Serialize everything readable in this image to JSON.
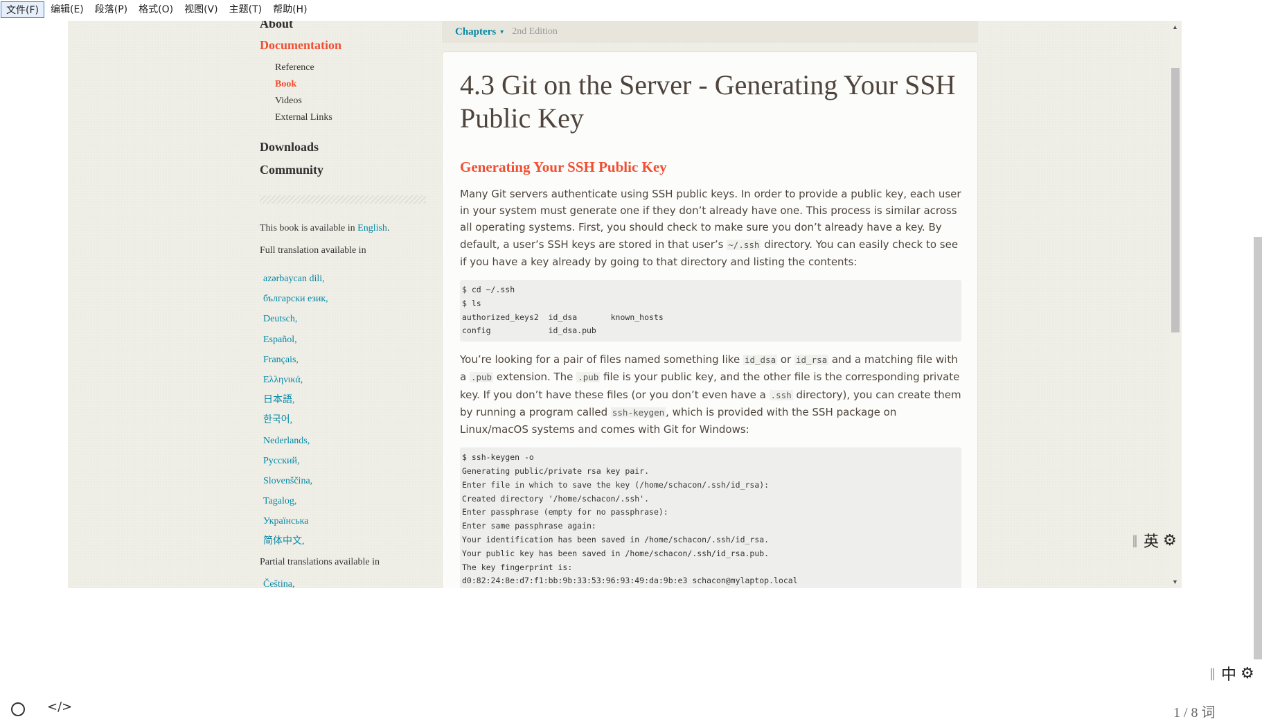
{
  "menubar": {
    "items": [
      "文件(F)",
      "编辑(E)",
      "段落(P)",
      "格式(O)",
      "视图(V)",
      "主题(T)",
      "帮助(H)"
    ]
  },
  "sidebar": {
    "about": "About",
    "documentation": "Documentation",
    "subitems": [
      "Reference",
      "Book",
      "Videos",
      "External Links"
    ],
    "downloads": "Downloads",
    "community": "Community",
    "available_prefix": "This book is available in ",
    "available_link": "English",
    "available_suffix": ".",
    "full_translation": "Full translation available in",
    "languages": [
      "azərbaycan dili,",
      "български език,",
      "Deutsch,",
      "Español,",
      "Français,",
      "Ελληνικά,",
      "日本語,",
      "한국어,",
      "Nederlands,",
      "Русский,",
      "Slovenščina,",
      "Tagalog,",
      "Українська",
      "简体中文,"
    ],
    "partial_translation": "Partial translations available in",
    "cut_language": "Čeština,"
  },
  "chapters_bar": {
    "label": "Chapters",
    "caret": "▾",
    "edition": "2nd Edition"
  },
  "content": {
    "title": "4.3 Git on the Server - Generating Your SSH Public Key",
    "section_heading": "Generating Your SSH Public Key",
    "para1": {
      "t1": "Many Git servers authenticate using SSH public keys. In order to provide a public key, each user in your system must generate one if they don’t already have one. This process is similar across all operating systems. First, you should check to make sure you don’t already have a key. By default, a user’s SSH keys are stored in that user’s ",
      "c1": "~/.ssh",
      "t2": " directory. You can easily check to see if you have a key already by going to that directory and listing the contents:"
    },
    "code1": "$ cd ~/.ssh\n$ ls\nauthorized_keys2  id_dsa       known_hosts\nconfig            id_dsa.pub",
    "para2": {
      "t1": "You’re looking for a pair of files named something like ",
      "c1": "id_dsa",
      "t2": " or ",
      "c2": "id_rsa",
      "t3": " and a matching file with a ",
      "c3": ".pub",
      "t4": " extension. The ",
      "c4": ".pub",
      "t5": " file is your public key, and the other file is the corresponding private key. If you don’t have these files (or you don’t even have a ",
      "c5": ".ssh",
      "t6": " directory), you can create them by running a program called ",
      "c6": "ssh-keygen",
      "t7": ", which is provided with the SSH package on Linux/macOS systems and comes with Git for Windows:"
    },
    "code2": "$ ssh-keygen -o\nGenerating public/private rsa key pair.\nEnter file in which to save the key (/home/schacon/.ssh/id_rsa):\nCreated directory '/home/schacon/.ssh'.\nEnter passphrase (empty for no passphrase):\nEnter same passphrase again:\nYour identification has been saved in /home/schacon/.ssh/id_rsa.\nYour public key has been saved in /home/schacon/.ssh/id_rsa.pub.\nThe key fingerprint is:\nd0:82:24:8e:d7:f1:bb:9b:33:53:96:93:49:da:9b:e3 schacon@mylaptop.local"
  },
  "scrollbar": {
    "up": "▲",
    "down": "▼"
  },
  "ime_inner": {
    "bar": "‖",
    "lang": "英",
    "gear": "⚙"
  },
  "ime_outer": {
    "bar": "‖",
    "lang": "中",
    "gear": "⚙"
  },
  "status": {
    "code_icon": "</>",
    "word_count": "1 / 8 词"
  }
}
